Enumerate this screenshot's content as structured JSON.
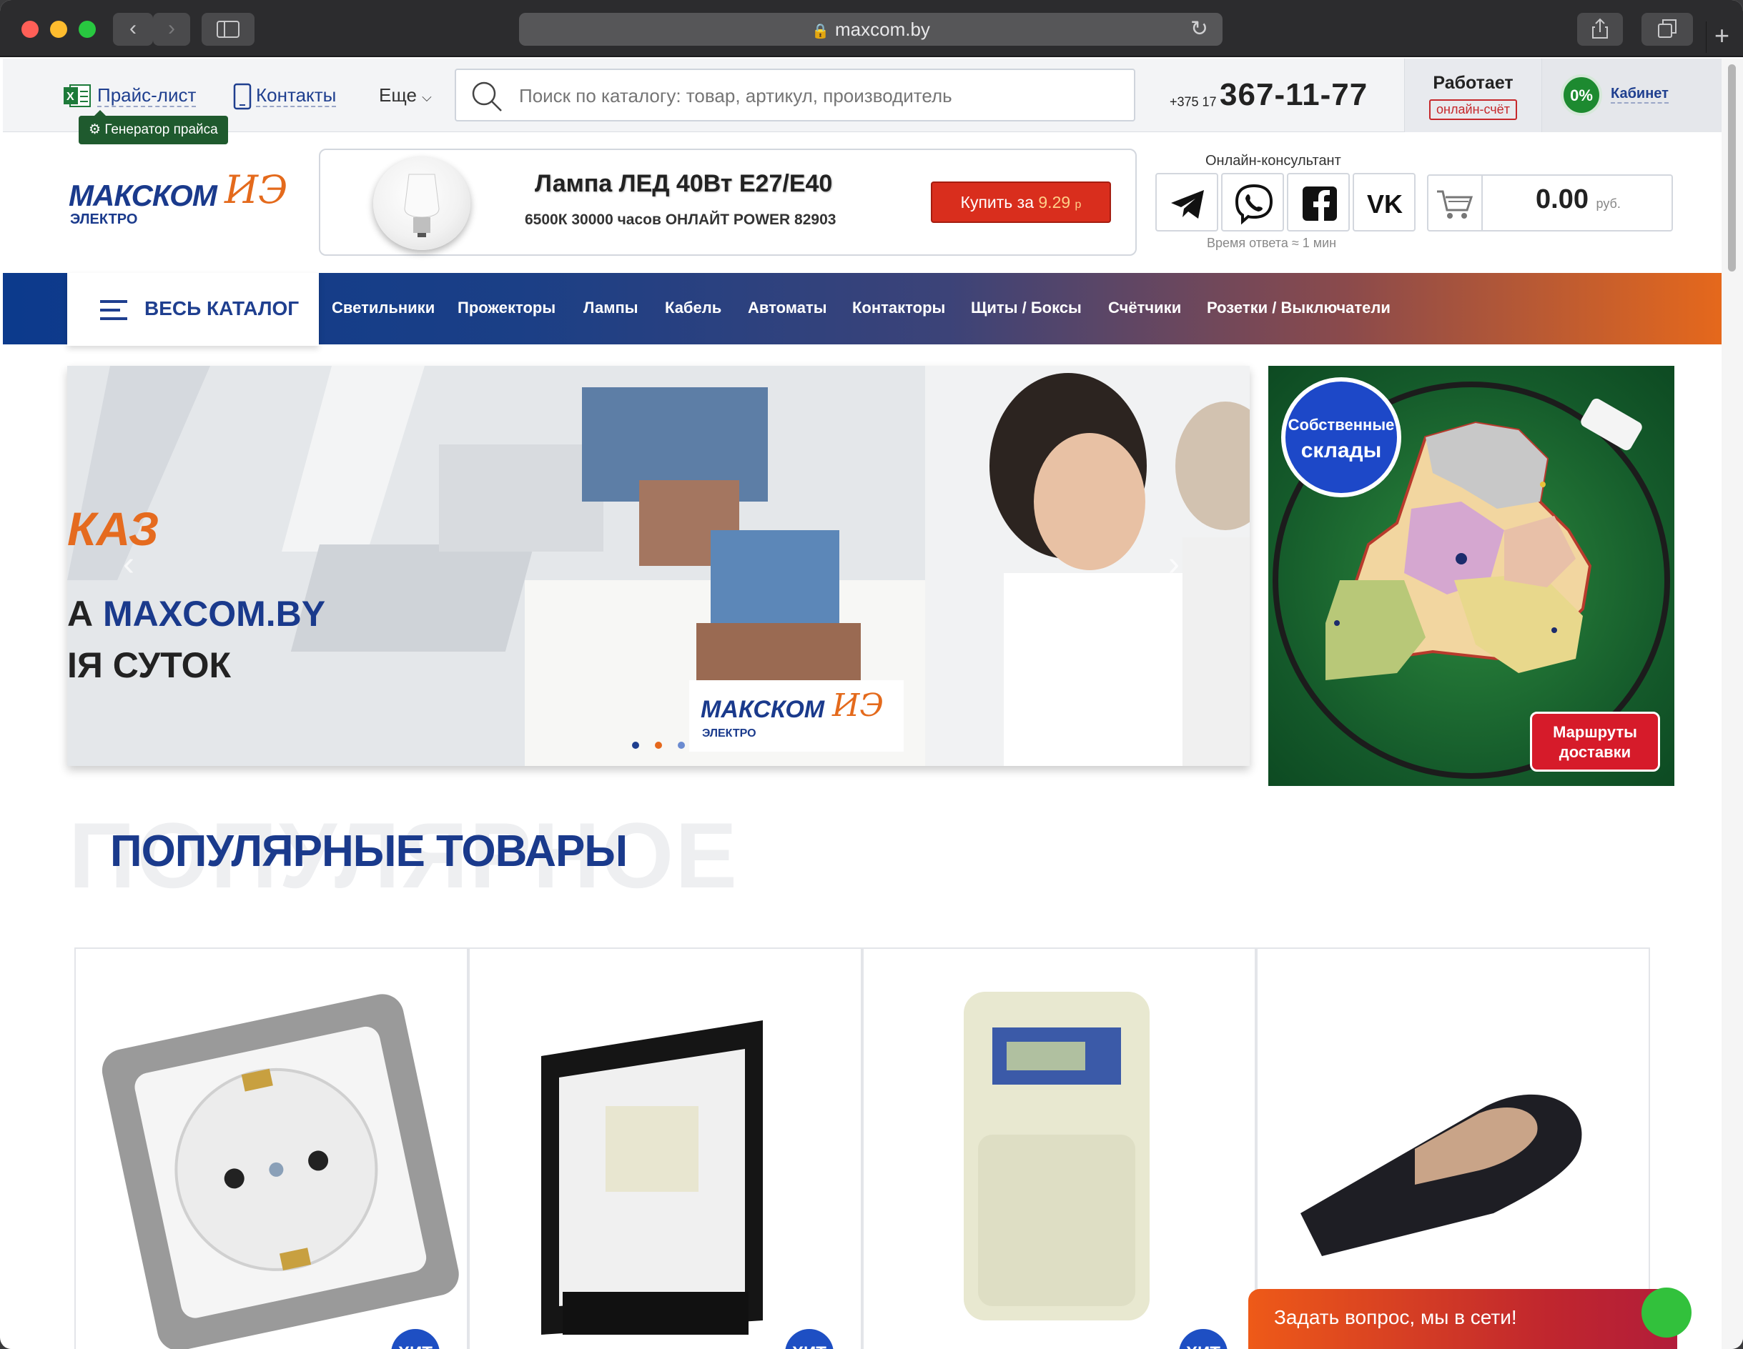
{
  "browser": {
    "url": "maxcom.by",
    "colors": {
      "red": "#ff5f57",
      "yellow": "#febc2e",
      "green": "#28c840"
    }
  },
  "topbar": {
    "price_list": "Прайс-лист",
    "contacts": "Контакты",
    "more": "Еще",
    "generator_tooltip": "Генератор прайса",
    "search_placeholder": "Поиск по каталогу: товар, артикул, производитель",
    "phone_code": "+375 17",
    "phone_number": "367-11-77",
    "works_label": "Работает",
    "online_invoice": "онлайн-счёт",
    "discount": "0%",
    "cabinet": "Кабинет"
  },
  "header": {
    "logo_main": "МАКСКОМ",
    "logo_script": "ИЭ",
    "logo_sub": "ЭЛЕКТРО",
    "promo_title": "Лампа ЛЕД 40Вт Е27/Е40",
    "promo_subtitle": "6500К 30000 часов ОНЛАЙТ POWER 82903",
    "buy_label": "Купить за",
    "buy_price": "9.29",
    "buy_currency": "р",
    "consultant_label": "Онлайн-консультант",
    "response_time": "Время ответа ≈ 1 мин",
    "cart_total": "0.00",
    "cart_currency": "руб."
  },
  "nav": {
    "catalog": "ВЕСЬ КАТАЛОГ",
    "items": [
      "Светильники",
      "Прожекторы",
      "Лампы",
      "Кабель",
      "Автоматы",
      "Контакторы",
      "Щиты / Боксы",
      "Счётчики",
      "Розетки / Выключатели"
    ]
  },
  "banner": {
    "text_top": "КАЗ",
    "text_mid_prefix": "А",
    "text_mid_brand": "MAXCOM.BY",
    "text_bottom": "ІЯ СУТОК",
    "logo_main": "МАКСКОМ",
    "logo_script": "ИЭ",
    "logo_sub": "ЭЛЕКТРО"
  },
  "banner2": {
    "warehouses_1": "Собственные",
    "warehouses_2": "склады",
    "routes_1": "Маршруты",
    "routes_2": "доставки"
  },
  "popular": {
    "title": "ПОПУЛЯРНЫЕ ТОВАРЫ",
    "bg_title": "ПОПУЛЯРНОЕ",
    "badge": "ХИТ"
  },
  "chat": {
    "label": "Задать вопрос, мы в сети!"
  }
}
